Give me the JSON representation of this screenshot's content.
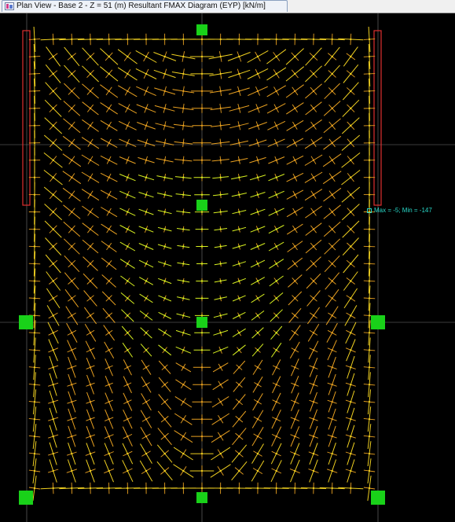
{
  "window": {
    "tab_title": "Plan View - Base 2 - Z = 51 (m)    Resultant FMAX Diagram    (EYP)  [kN/m]"
  },
  "diagram": {
    "legend_text": "Max = -5;  Min = -147",
    "colors": {
      "background": "#000000",
      "gridline": "#7a7a7a",
      "support": "#19d119",
      "wall_outline": "#e03030",
      "arrow_strong": "#f0d020",
      "arrow_mid": "#e8a020",
      "arrow_weak": "#d8f020",
      "legend": "#28d8c8"
    }
  }
}
